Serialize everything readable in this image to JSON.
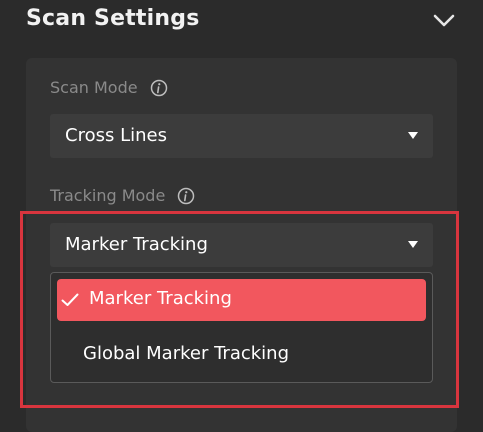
{
  "header": {
    "title": "Scan Settings",
    "collapse_icon": "chevron-down-icon"
  },
  "scan_mode": {
    "label": "Scan Mode",
    "info_icon": "info-icon",
    "value": "Cross Lines"
  },
  "tracking_mode": {
    "label": "Tracking Mode",
    "info_icon": "info-icon",
    "value": "Marker Tracking",
    "options": [
      {
        "label": "Marker Tracking",
        "selected": true
      },
      {
        "label": "Global Marker Tracking",
        "selected": false
      }
    ]
  },
  "colors": {
    "accent": "#f2575e",
    "highlight_border": "#d8353e",
    "background": "#2b2b2b",
    "panel": "#333333"
  }
}
